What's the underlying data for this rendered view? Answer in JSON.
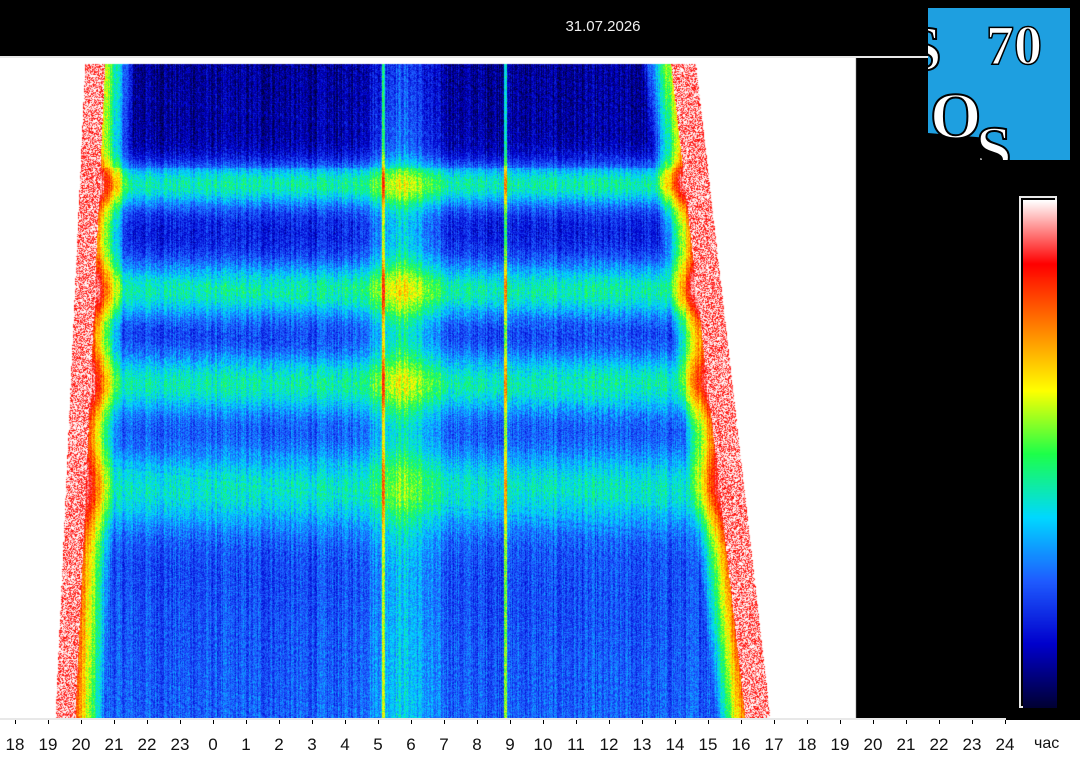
{
  "chart_data": {
    "type": "heatmap",
    "title": "31.07.2026",
    "x_tick_labels": [
      "18",
      "19",
      "20",
      "21",
      "22",
      "23",
      "0",
      "1",
      "2",
      "3",
      "4",
      "5",
      "6",
      "7",
      "8",
      "9",
      "10",
      "11",
      "12",
      "13",
      "14",
      "15",
      "16",
      "17",
      "18",
      "19",
      "20",
      "21",
      "22",
      "23",
      "24"
    ],
    "x_unit": "час",
    "x_range_hours": [
      18,
      24
    ],
    "frequency_bands_description": "Horizontal resonance bands",
    "data_span_ticks": [
      20,
      19
    ],
    "colormap": [
      "#000033",
      "#0000cc",
      "#1f5cff",
      "#00d8ff",
      "#1dff4a",
      "#ffff00",
      "#ff8000",
      "#ff0000",
      "#ffffff"
    ],
    "grid": false,
    "legend": "colorbar-right"
  },
  "logo": {
    "letters": [
      "S",
      "70",
      "O",
      "S"
    ],
    "background": "#1e9fe0",
    "letter_color": "#ffffff"
  },
  "colors": {
    "background": "#000000",
    "axis_text": "#111111",
    "title_text": "#f0f0f0",
    "saturated": "#ffffff"
  }
}
